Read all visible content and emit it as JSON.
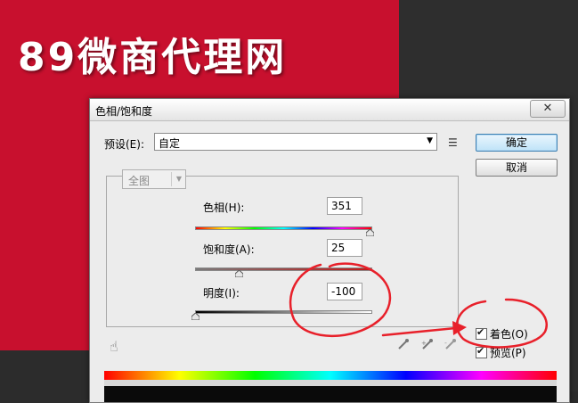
{
  "watermark": {
    "text": "89微商代理网"
  },
  "dialog": {
    "title": "色相/饱和度",
    "close_glyph": "✕",
    "preset": {
      "label": "预设(E):",
      "value": "自定"
    },
    "buttons": {
      "ok": "确定",
      "cancel": "取消"
    },
    "channel": {
      "value": "全图"
    },
    "hue": {
      "label": "色相(H):",
      "value": "351",
      "level": 0.987
    },
    "saturation": {
      "label": "饱和度(A):",
      "value": "25",
      "level": 0.25
    },
    "lightness": {
      "label": "明度(I):",
      "value": "-100",
      "level": 0.0
    },
    "colorize": {
      "label": "着色(O)",
      "checked": true
    },
    "preview": {
      "label": "预览(P)",
      "checked": true
    }
  },
  "annotation": {
    "color": "#e8202a",
    "icon": "hand-drawn-circles-and-arrow"
  },
  "colors": {
    "background_red": "#c8102e",
    "background_dark": "#2e2e2e",
    "ok_button": "#bfe3f8"
  }
}
